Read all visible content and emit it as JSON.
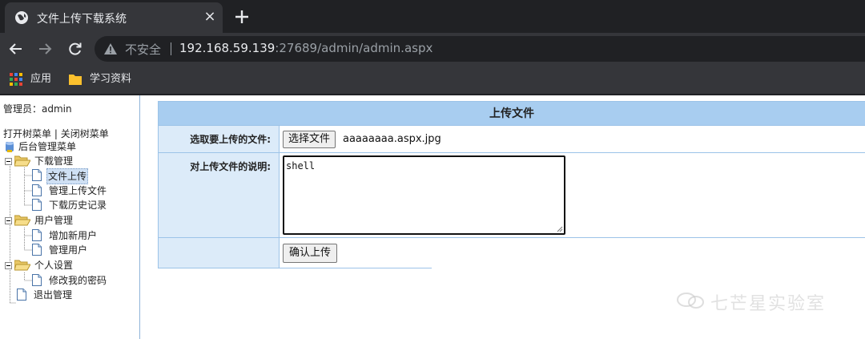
{
  "browser": {
    "tab_title": "文件上传下载系统",
    "tab_close": "×",
    "insecure_label": "不安全",
    "url_host": "192.168.59.139",
    "url_rest": ":27689/admin/admin.aspx",
    "bookmarks": [
      {
        "label": "应用"
      },
      {
        "label": "学习资料"
      }
    ]
  },
  "sidebar": {
    "admin_line": "管理员：admin",
    "open_tree": "打开树菜单",
    "separator": " | ",
    "close_tree": "关闭树菜单",
    "root": "后台管理菜单",
    "groups": [
      {
        "label": "下载管理",
        "items": [
          {
            "label": "文件上传"
          },
          {
            "label": "管理上传文件"
          },
          {
            "label": "下载历史记录"
          }
        ]
      },
      {
        "label": "用户管理",
        "items": [
          {
            "label": "增加新用户"
          },
          {
            "label": "管理用户"
          }
        ]
      },
      {
        "label": "个人设置",
        "items": [
          {
            "label": "修改我的密码"
          }
        ]
      }
    ],
    "logout": "退出管理"
  },
  "form": {
    "title": "上传文件",
    "file_label": "选取要上传的文件:",
    "file_button": "选择文件",
    "file_name": "aaaaaaaa.aspx.jpg",
    "desc_label": "对上传文件的说明:",
    "desc_value": "shell",
    "submit": "确认上传"
  },
  "watermark": "七芒星实验室",
  "colors": {
    "tab_bg": "#35363a",
    "header_blue": "#a8cdf0",
    "label_blue": "#dcebf9"
  }
}
